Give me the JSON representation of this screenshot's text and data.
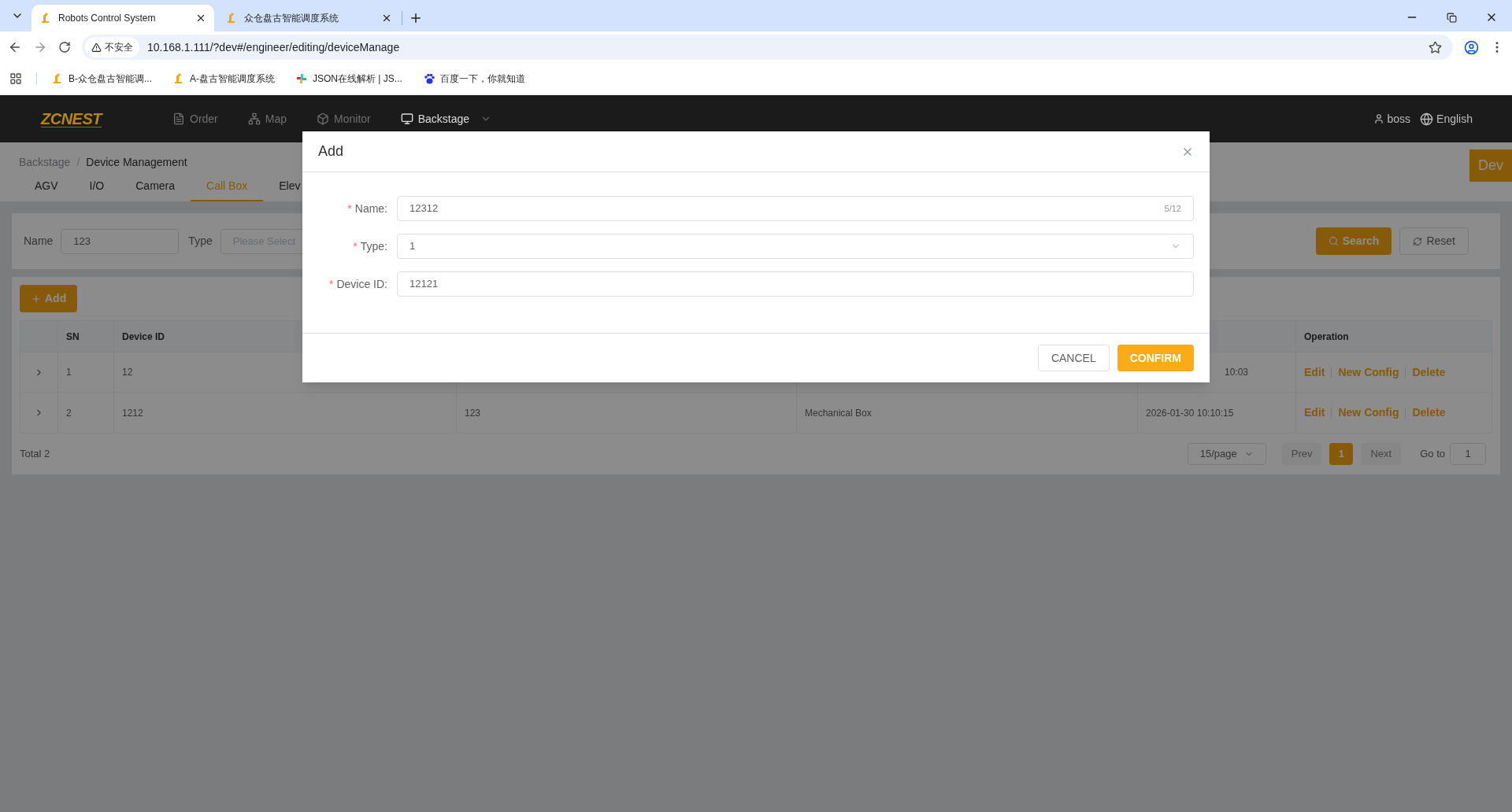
{
  "browser": {
    "tabs": [
      {
        "title": "Robots Control System",
        "selected": true
      },
      {
        "title": "众仓盘古智能调度系统",
        "selected": false
      }
    ],
    "security_label": "不安全",
    "url": "10.168.1.111/?dev#/engineer/editing/deviceManage",
    "bookmarks": [
      {
        "label": "B-众仓盘古智能调...",
        "kind": "robot"
      },
      {
        "label": "A-盘古智能调度系统",
        "kind": "robot"
      },
      {
        "label": "JSON在线解析 | JS...",
        "kind": "pinwheel"
      },
      {
        "label": "百度一下，你就知道",
        "kind": "paw"
      }
    ]
  },
  "header": {
    "logo": "ZCNEST",
    "nav": [
      {
        "label": "Order",
        "selected": false,
        "dropdown": false
      },
      {
        "label": "Map",
        "selected": false,
        "dropdown": false
      },
      {
        "label": "Monitor",
        "selected": false,
        "dropdown": false
      },
      {
        "label": "Backstage",
        "selected": true,
        "dropdown": true
      }
    ],
    "user": "boss",
    "language": "English"
  },
  "breadcrumb": {
    "items": [
      "Backstage",
      "Device Management"
    ],
    "separator": "/"
  },
  "device_tabs": [
    {
      "label": "AGV",
      "selected": false
    },
    {
      "label": "I/O",
      "selected": false
    },
    {
      "label": "Camera",
      "selected": false
    },
    {
      "label": "Call Box",
      "selected": true
    },
    {
      "label": "Elev",
      "selected": false
    }
  ],
  "dev_badge": "Dev",
  "filters": {
    "name_label": "Name",
    "name_value": "123",
    "type_label": "Type",
    "type_placeholder": "Please Select",
    "search": "Search",
    "reset": "Reset"
  },
  "add_button": "Add",
  "table": {
    "header": {
      "sn": "SN",
      "device_id": "Device ID",
      "operation": "Operation"
    },
    "rows": [
      {
        "expanded": false,
        "sn": "1",
        "device_id": "12",
        "column_5": "10:03",
        "actions": [
          "Edit",
          "New Config",
          "Delete"
        ]
      },
      {
        "expanded": false,
        "sn": "2",
        "device_id": "1212",
        "column_3": "123",
        "column_4": "Mechanical Box",
        "column_5": "2026-01-30 10:10:15",
        "actions": [
          "Edit",
          "New Config",
          "Delete"
        ]
      }
    ]
  },
  "total": "Total 2",
  "pagination": {
    "page_size": "15/page",
    "prev": "Prev",
    "next": "Next",
    "prev_disabled": true,
    "next_disabled": true,
    "pages": [
      {
        "label": "1",
        "selected": true
      }
    ],
    "goto_label": "Go to",
    "goto_value": "1"
  },
  "dialog": {
    "title": "Add",
    "fields": [
      {
        "kind": "text",
        "label": "Name:",
        "required_mark": "*",
        "value": "12312",
        "count": "5/12"
      },
      {
        "kind": "select",
        "label": "Type:",
        "required_mark": "*",
        "value": "1"
      },
      {
        "kind": "text",
        "label": "Device ID:",
        "required_mark": "*",
        "value": "12121"
      }
    ],
    "cancel": "CANCEL",
    "confirm": "CONFIRM"
  }
}
